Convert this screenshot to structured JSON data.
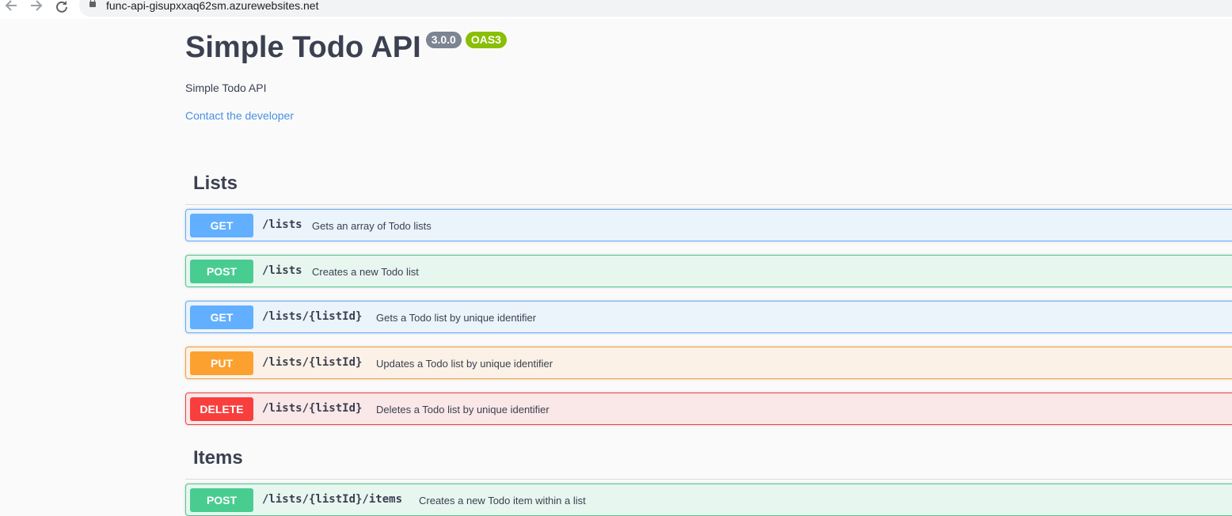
{
  "browser": {
    "url": "func-api-gisupxxaq62sm.azurewebsites.net"
  },
  "info": {
    "title": "Simple Todo API",
    "version": "3.0.0",
    "oas_badge": "OAS3",
    "description": "Simple Todo API",
    "contact_link": "Contact the developer"
  },
  "sections": [
    {
      "name": "Lists",
      "operations": [
        {
          "method": "GET",
          "path": "/lists",
          "summary": "Gets an array of Todo lists"
        },
        {
          "method": "POST",
          "path": "/lists",
          "summary": "Creates a new Todo list"
        },
        {
          "method": "GET",
          "path": "/lists/{listId}",
          "summary": "Gets a Todo list by unique identifier"
        },
        {
          "method": "PUT",
          "path": "/lists/{listId}",
          "summary": "Updates a Todo list by unique identifier"
        },
        {
          "method": "DELETE",
          "path": "/lists/{listId}",
          "summary": "Deletes a Todo list by unique identifier"
        }
      ]
    },
    {
      "name": "Items",
      "operations": [
        {
          "method": "POST",
          "path": "/lists/{listId}/items",
          "summary": "Creates a new Todo item within a list"
        }
      ]
    }
  ],
  "colors": {
    "get": "#61affe",
    "post": "#49cc90",
    "put": "#fca130",
    "delete": "#f93e3e",
    "link": "#4990e2"
  },
  "icons": [
    "back-arrow-icon",
    "forward-arrow-icon",
    "reload-icon",
    "lock-icon"
  ]
}
